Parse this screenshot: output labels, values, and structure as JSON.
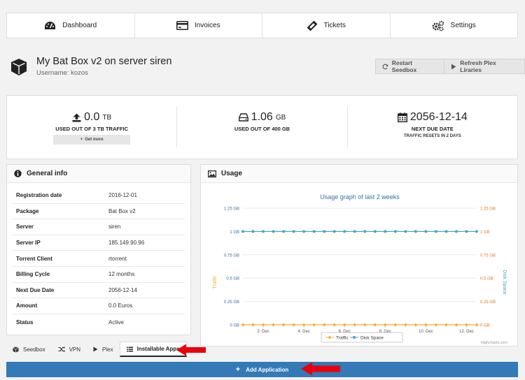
{
  "nav": [
    {
      "label": "Dashboard",
      "icon": "dashboard-icon"
    },
    {
      "label": "Invoices",
      "icon": "credit-card-icon"
    },
    {
      "label": "Tickets",
      "icon": "ticket-icon"
    },
    {
      "label": "Settings",
      "icon": "gears-icon"
    }
  ],
  "header": {
    "title": "My Bat Box v2 on server siren",
    "username": "Username: kozos",
    "restart_label": "Restart Seedbox",
    "refresh_label": "Refresh Plex Liraries"
  },
  "stats": {
    "traffic": {
      "value": "0.0",
      "unit": "TB",
      "label": "USED OUT OF 3 TB TRAFFIC",
      "get_more": "Get more"
    },
    "disk": {
      "value": "1.06",
      "unit": "GB",
      "label": "USED OUT OF 400 GB"
    },
    "due": {
      "value": "2056-12-14",
      "label": "NEXT DUE DATE",
      "note": "TRAFFIC RESETS IN 2 DAYS"
    }
  },
  "general_info": {
    "title": "General info",
    "rows": [
      {
        "key": "Registration date",
        "value": "2016-12-01"
      },
      {
        "key": "Package",
        "value": "Bat Box v2"
      },
      {
        "key": "Server",
        "value": "siren"
      },
      {
        "key": "Server IP",
        "value": "185.149.90.96"
      },
      {
        "key": "Torrent Client",
        "value": "rtorrent"
      },
      {
        "key": "Billing Cycle",
        "value": "12 months"
      },
      {
        "key": "Next Due Date",
        "value": "2056-12-14"
      },
      {
        "key": "Amount",
        "value": "0.0 Euros"
      },
      {
        "key": "Status",
        "value": "Active"
      }
    ]
  },
  "usage": {
    "title": "Usage"
  },
  "chart_data": {
    "type": "line",
    "title": "Usage graph of last 2 weeks",
    "ylabel": "Traffic",
    "y2label": "Disk Space",
    "ylim": [
      0,
      1.25
    ],
    "y_ticks": [
      "0 GB",
      "0.25 GB",
      "0.5 GB",
      "0.75 GB",
      "1 GB",
      "1.25 GB"
    ],
    "x_ticks": [
      "2. Dec",
      "4. Dec",
      "6. Dec",
      "8. Dec",
      "10. Dec",
      "12. Dec"
    ],
    "x": [
      1,
      1.5,
      2,
      2.5,
      3,
      3.5,
      4,
      4.5,
      5,
      5.5,
      6,
      6.5,
      7,
      7.5,
      8,
      8.5,
      9,
      9.5,
      10,
      10.5,
      11,
      11.5,
      12,
      12.5
    ],
    "series": [
      {
        "name": "Traffic",
        "axis": "left",
        "color": "#f0b030",
        "values": [
          0,
          0,
          0,
          0,
          0,
          0,
          0,
          0,
          0,
          0,
          0,
          0,
          0,
          0,
          0,
          0,
          0,
          0,
          0,
          0,
          0,
          0,
          0,
          0
        ]
      },
      {
        "name": "Disk Space",
        "axis": "right",
        "color": "#4aa3c9",
        "values": [
          1.0,
          1.0,
          1.0,
          1.0,
          1.0,
          1.0,
          1.0,
          1.0,
          1.0,
          1.0,
          1.0,
          1.0,
          1.0,
          1.0,
          1.0,
          1.0,
          1.0,
          1.0,
          1.0,
          1.0,
          1.0,
          1.0,
          1.0,
          1.0
        ]
      }
    ],
    "legend": "bottom",
    "credit": "Highcharts.com",
    "grid": true
  },
  "tabs": [
    {
      "label": "Seedbox",
      "icon": "box-icon",
      "active": false
    },
    {
      "label": "VPN",
      "icon": "shuffle-icon",
      "active": false
    },
    {
      "label": "Plex",
      "icon": "play-icon",
      "active": false
    },
    {
      "label": "Installable Apps",
      "icon": "list-icon",
      "active": true
    }
  ],
  "add_application": "Add Application",
  "colors": {
    "primary": "#337ab7",
    "arrow": "#e8000b",
    "traffic": "#f0b030",
    "disk": "#4aa3c9"
  }
}
